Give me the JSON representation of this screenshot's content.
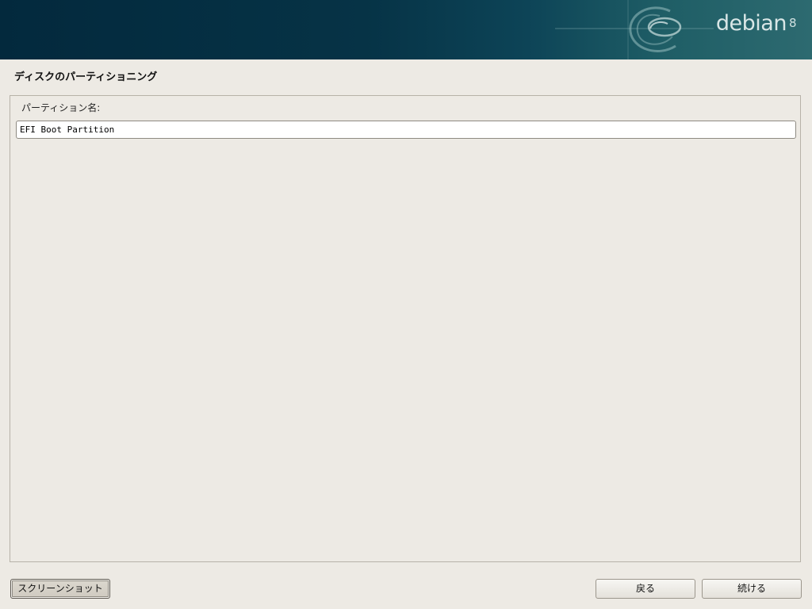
{
  "banner": {
    "brand_name": "debian",
    "brand_version": "8",
    "logo_icon": "debian-swirl-icon",
    "colors": {
      "dark": "#03293d",
      "mid": "#0d4457",
      "light": "#2d6a70",
      "brand_text": "#d9e6e6"
    }
  },
  "page": {
    "title": "ディスクのパーティショニング",
    "background": "#edeae4"
  },
  "form": {
    "label": "パーティション名:",
    "value": "EFI Boot Partition",
    "placeholder": ""
  },
  "buttons": {
    "screenshot": "スクリーンショット",
    "back": "戻る",
    "continue": "続ける"
  }
}
